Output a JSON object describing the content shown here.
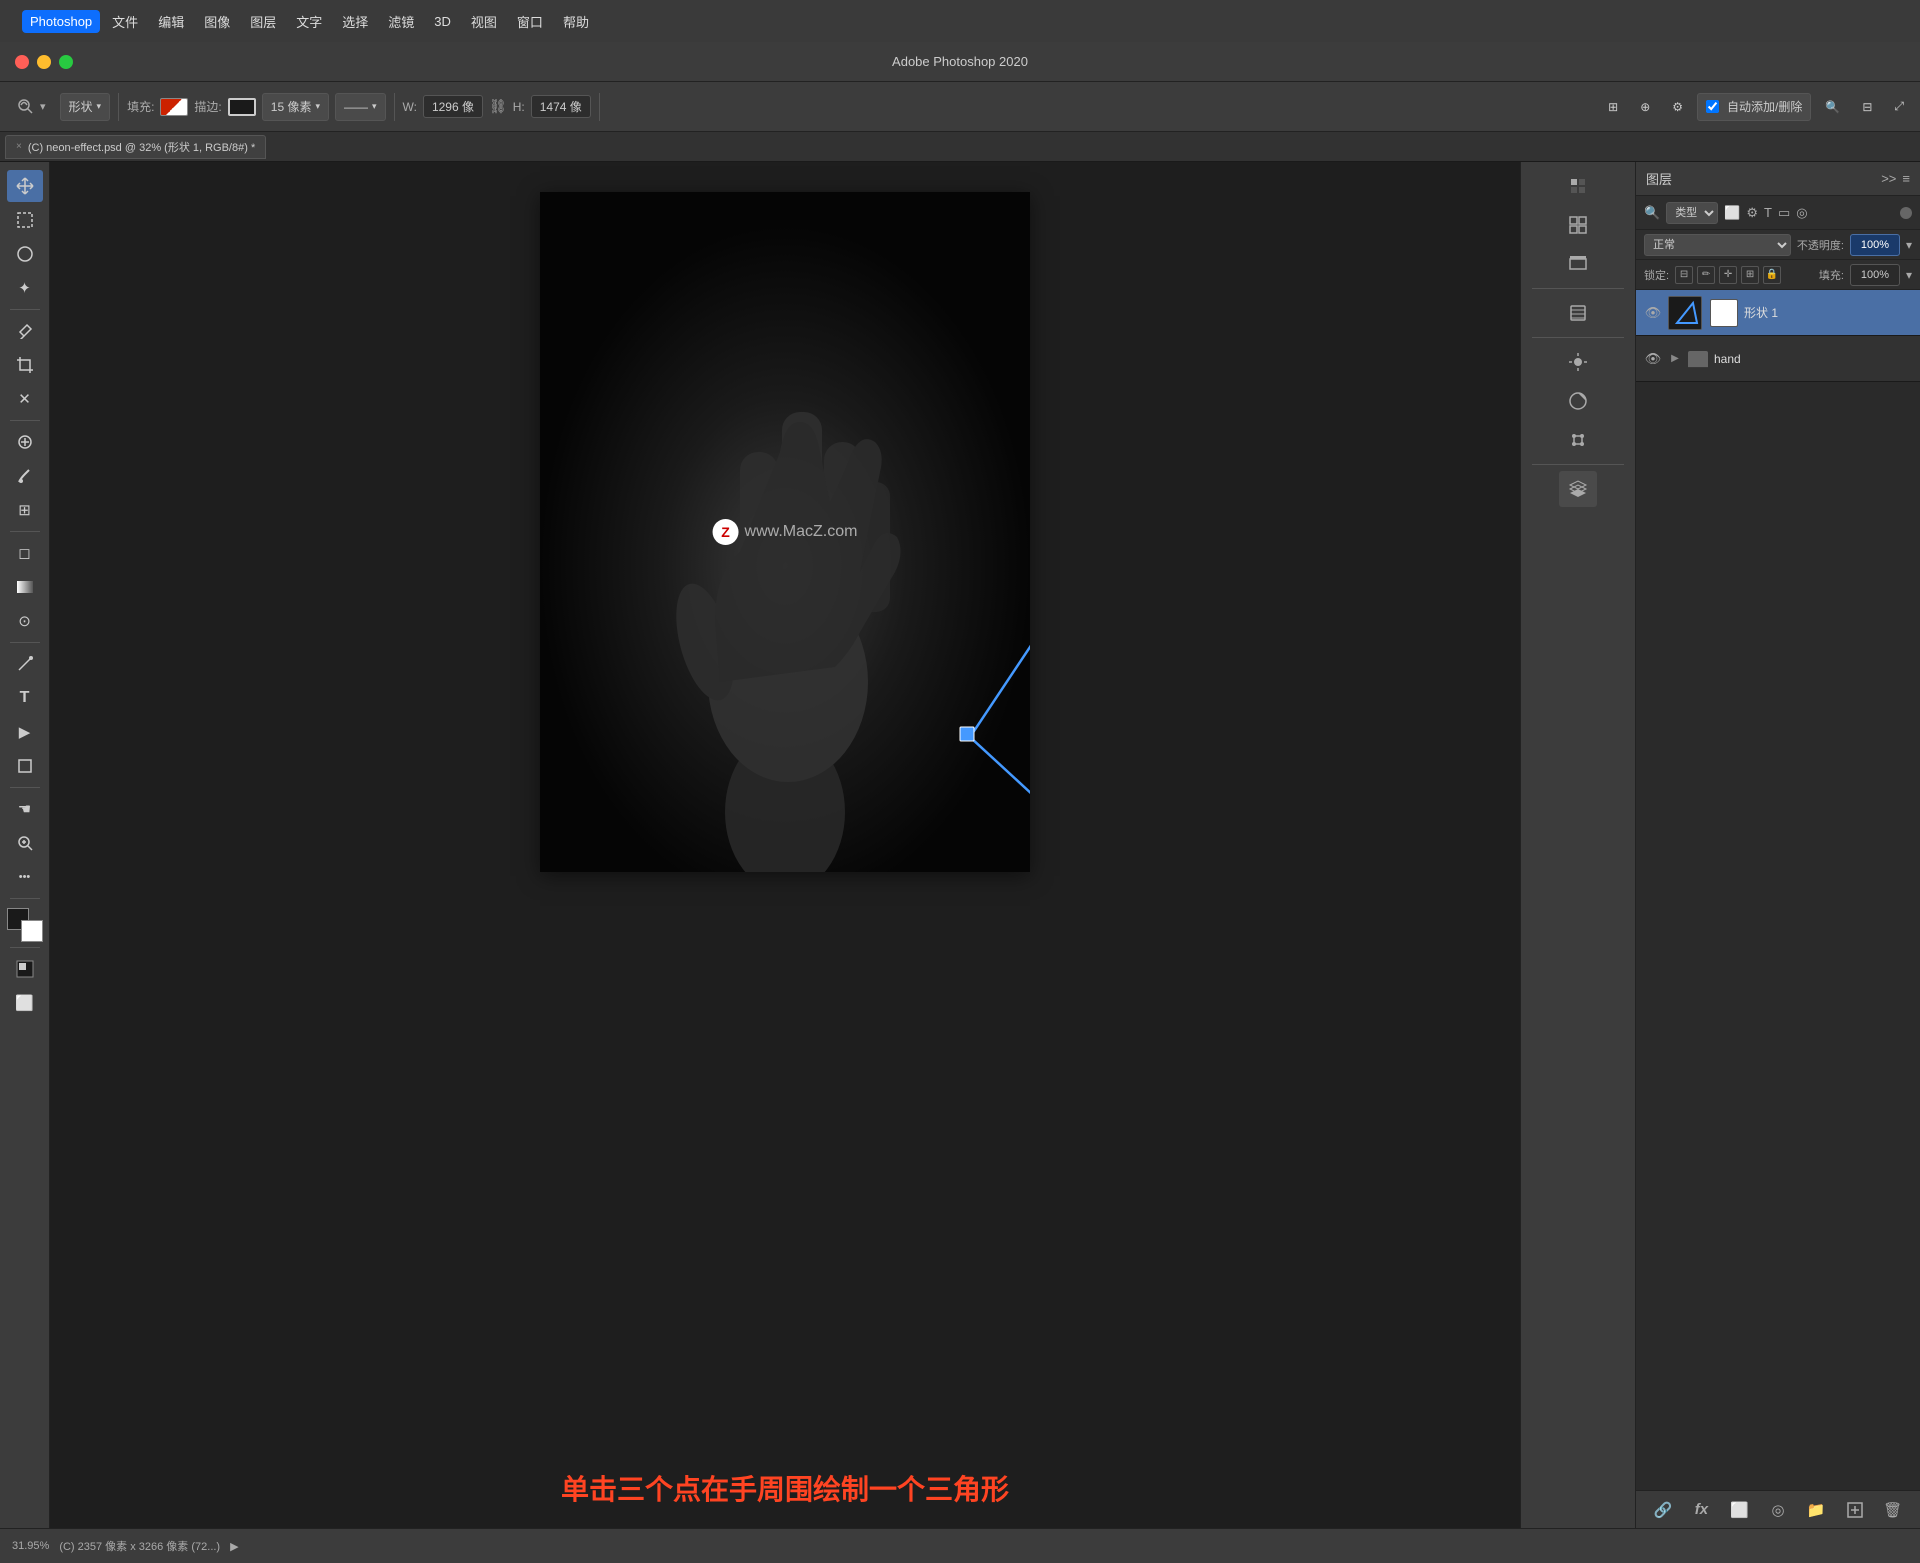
{
  "app": {
    "name": "Photoshop",
    "title": "Adobe Photoshop 2020"
  },
  "menubar": {
    "apple": "⌘",
    "items": [
      "Photoshop",
      "文件",
      "编辑",
      "图像",
      "图层",
      "文字",
      "选择",
      "滤镜",
      "3D",
      "视图",
      "窗口",
      "帮助"
    ]
  },
  "window_controls": {
    "close": "×",
    "minimize": "−",
    "maximize": "+"
  },
  "toolbar": {
    "shape_select": "形状",
    "fill_label": "填充:",
    "stroke_label": "描边:",
    "stroke_size": "15 像素",
    "width_label": "W:",
    "width_value": "1296 像",
    "height_label": "H:",
    "height_value": "1474 像",
    "auto_label": "自动添加/删除"
  },
  "doc_tab": {
    "close": "×",
    "name": "(C) neon-effect.psd @ 32% (形状 1, RGB/8#) *"
  },
  "tools": {
    "move": "✛",
    "select_rect": "▭",
    "lasso": "○",
    "magic_wand": "✦",
    "eyedropper": "⊕",
    "crop": "⌗",
    "x_mark": "✕",
    "heal": "✚",
    "brush": "✏",
    "stamp": "⊞",
    "eraser": "◻",
    "gradient": "▦",
    "burn": "⊙",
    "pen": "✒",
    "text": "T",
    "path_sel": "▶",
    "shape": "▭",
    "hand": "☚",
    "zoom": "⊕",
    "more": "•••"
  },
  "watermark": {
    "logo": "Z",
    "text": "www.MacZ.com"
  },
  "caption": "单击三个点在手周围绘制一个三角形",
  "layers_panel": {
    "title": "图层",
    "filter_label": "类型",
    "blend_mode": "正常",
    "opacity_label": "不透明度:",
    "opacity_value": "100%",
    "lock_label": "锁定:",
    "fill_label": "填充:",
    "fill_value": "100%",
    "layers": [
      {
        "id": 1,
        "name": "形状 1",
        "type": "shape",
        "visible": true,
        "selected": true
      },
      {
        "id": 2,
        "name": "hand",
        "type": "folder",
        "visible": true,
        "selected": false
      }
    ],
    "bottom_icons": [
      "link",
      "fx",
      "mask",
      "adjust",
      "folder",
      "new",
      "delete"
    ]
  },
  "statusbar": {
    "zoom": "31.95%",
    "info": "(C) 2357 像素 x 3266 像素 (72...)"
  },
  "right_panel": {
    "icons": [
      "palette",
      "grid",
      "square",
      "pattern",
      "bulb",
      "circle",
      "transform"
    ]
  }
}
